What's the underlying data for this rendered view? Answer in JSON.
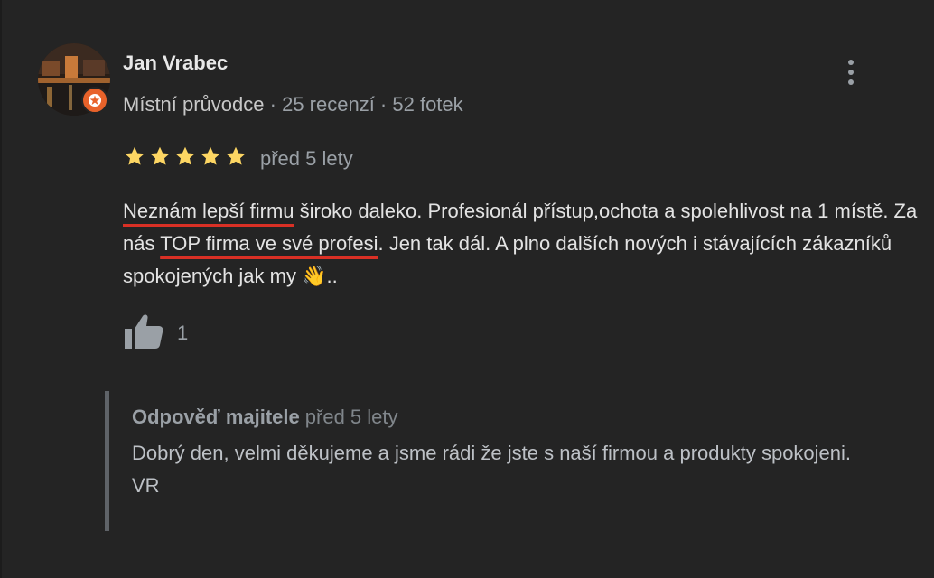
{
  "reviewer": {
    "name": "Jan Vrabec",
    "badge": "Místní průvodce",
    "reviews": "25 recenzí",
    "photos": "52 fotek",
    "separator": " · "
  },
  "review": {
    "rating": 5,
    "rating_max": 5,
    "time": "před 5 lety",
    "text_part1": "Neznám lepší firmu",
    "text_part2": " široko daleko. Profesionál přístup,ochota a spolehlivost na 1 místě. Za nás ",
    "text_part3": "TOP firma ve své profesi",
    "text_part4": ". Jen tak dál. A plno dalších nových i stávajících zákazníků spokojených jak my 👋..",
    "likes": "1"
  },
  "reply": {
    "title": "Odpověď majitele",
    "time": "před 5 lety",
    "text": "Dobrý den, velmi děkujeme a jsme rádi že jste s naší firmou a produkty spokojeni.\nVR"
  },
  "icons": {
    "more": "more-vert-icon",
    "like": "thumb-up-icon",
    "star": "star-icon",
    "guide_badge": "local-guide-badge-icon"
  },
  "colors": {
    "background": "#242424",
    "star": "#fdd663",
    "underline": "#d93025",
    "badge": "#e8622a",
    "muted_text": "#9aa0a6"
  }
}
